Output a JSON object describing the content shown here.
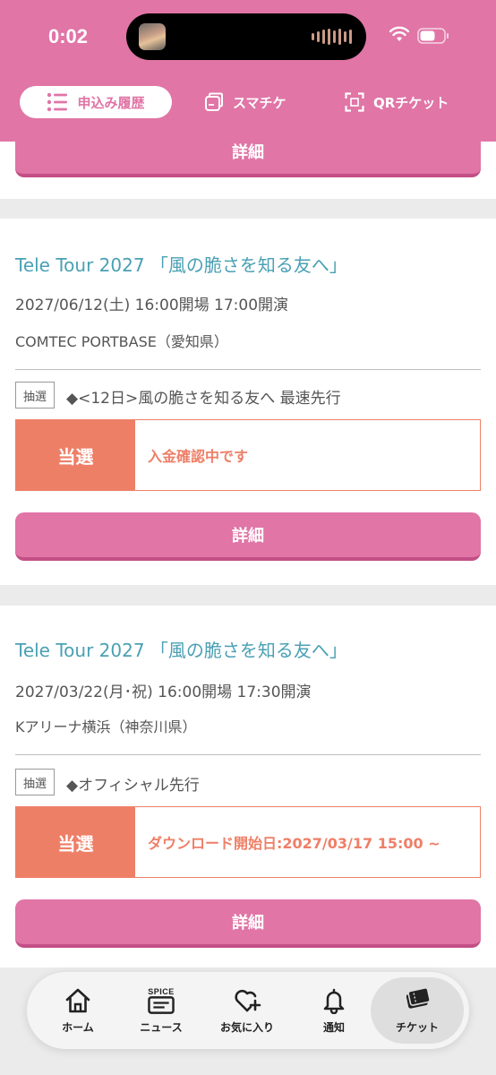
{
  "status_bar": {
    "time": "0:02"
  },
  "header_tabs": {
    "history": "申込み履歴",
    "sumachike": "スマチケ",
    "qr_ticket": "QRチケット"
  },
  "detail_label": "詳細",
  "entries": [
    {
      "title": "Tele Tour 2027 「風の脆さを知る友へ」",
      "datetime": "2027/06/12(土) 16:00開場 17:00開演",
      "venue": "COMTEC PORTBASE（愛知県）",
      "lottery_tag": "抽選",
      "lottery_name": "◆<12日>風の脆さを知る友へ 最速先行",
      "result": "当選",
      "status": "入金確認中です",
      "detail": "詳細"
    },
    {
      "title": "Tele Tour 2027 「風の脆さを知る友へ」",
      "datetime": "2027/03/22(月･祝) 16:00開場 17:30開演",
      "venue": "Kアリーナ横浜（神奈川県）",
      "lottery_tag": "抽選",
      "lottery_name": "◆オフィシャル先行",
      "result": "当選",
      "status": "ダウンロード開始日:2027/03/17 15:00 ~",
      "detail": "詳細"
    }
  ],
  "bottom_nav": {
    "home": "ホーム",
    "spice_logo": "SPICE",
    "news": "ニュース",
    "favorites": "お気に入り",
    "notifications": "通知",
    "ticket": "チケット"
  },
  "colors": {
    "brand_pink": "#e075a6",
    "title_teal": "#4aa0b4",
    "result_orange": "#ee7f67"
  }
}
